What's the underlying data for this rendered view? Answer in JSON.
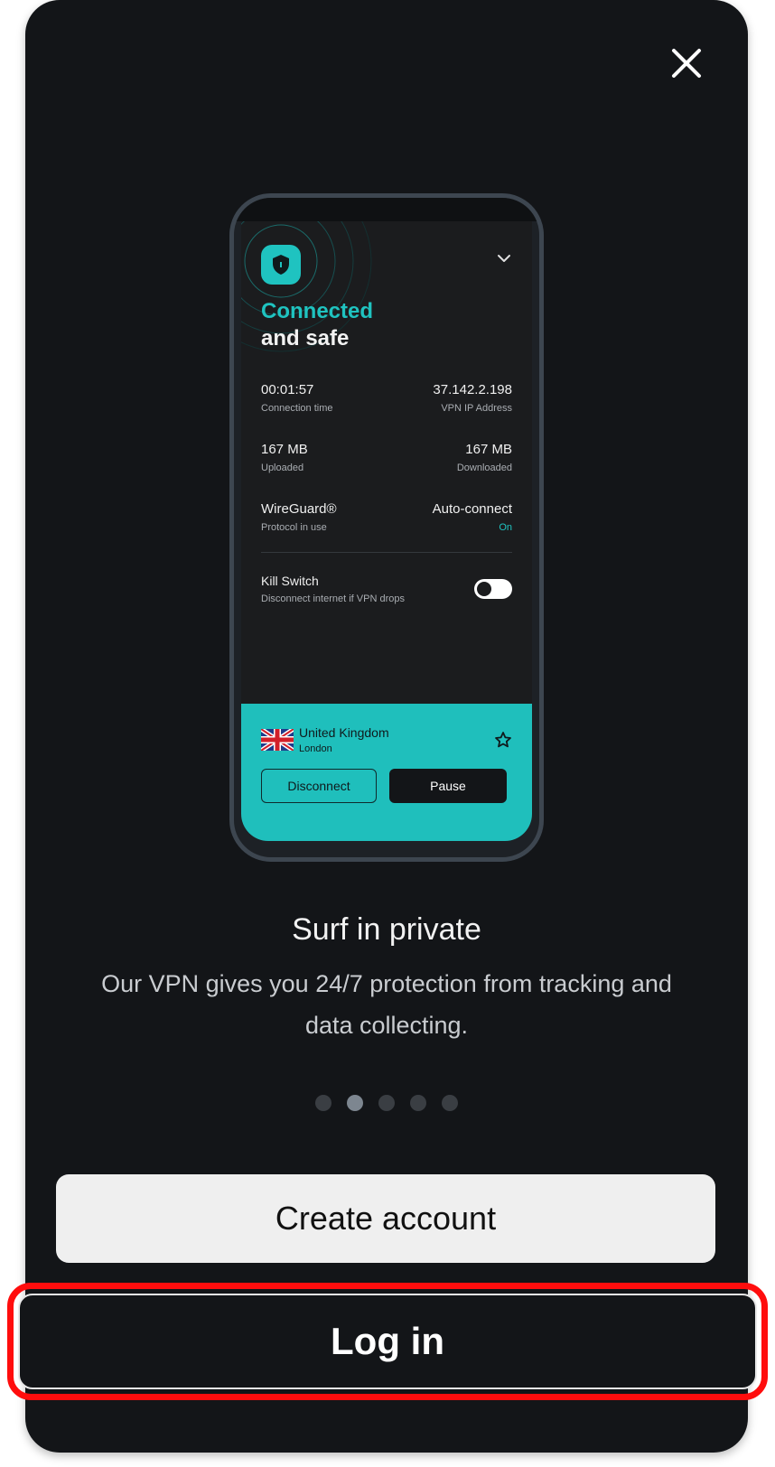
{
  "phone": {
    "status_line1": "Connected",
    "status_line2": "and safe",
    "stats": {
      "connection_time": {
        "value": "00:01:57",
        "label": "Connection time"
      },
      "vpn_ip": {
        "value": "37.142.2.198",
        "label": "VPN IP Address"
      },
      "uploaded": {
        "value": "167 MB",
        "label": "Uploaded"
      },
      "downloaded": {
        "value": "167 MB",
        "label": "Downloaded"
      },
      "protocol": {
        "value": "WireGuard®",
        "label": "Protocol in use"
      },
      "auto_connect": {
        "value": "Auto-connect",
        "label": "On"
      }
    },
    "kill_switch": {
      "title": "Kill Switch",
      "desc": "Disconnect internet if VPN drops"
    },
    "location": {
      "country": "United Kingdom",
      "city": "London"
    },
    "buttons": {
      "disconnect": "Disconnect",
      "pause": "Pause"
    }
  },
  "onboarding": {
    "title": "Surf in private",
    "subtitle": "Our VPN gives you 24/7 protection from tracking and data collecting.",
    "page_index": 2,
    "page_count": 5
  },
  "actions": {
    "create_account": "Create account",
    "login": "Log in"
  },
  "colors": {
    "accent": "#1fc3c0",
    "background": "#131518",
    "highlight": "#ff0d0d"
  },
  "icons": [
    "close-icon",
    "shield-icon",
    "chevron-down-icon",
    "uk-flag-icon",
    "star-icon"
  ]
}
